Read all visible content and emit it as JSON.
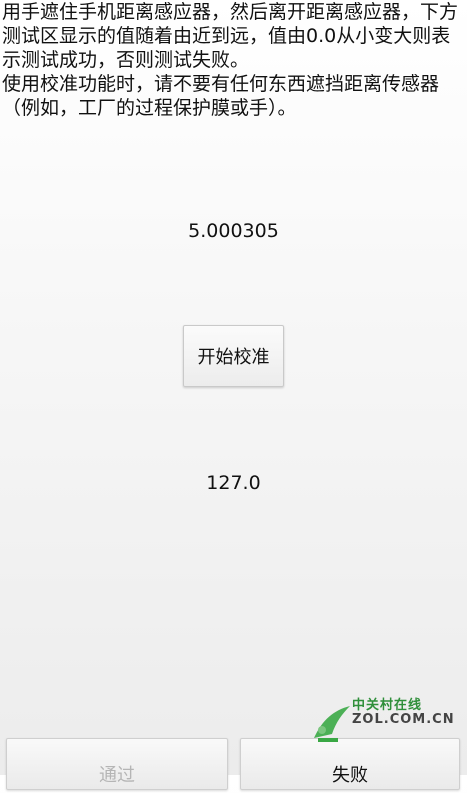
{
  "instructions": "用手遮住手机距离感应器，然后离开距离感应器，下方测试区显示的值随着由近到远，值由0.0从小变大则表示测试成功，否则测试失败。\n使用校准功能时，请不要有任何东西遮挡距离传感器（例如，工厂的过程保护膜或手）。",
  "reading_top": "5.000305",
  "calibrate_button": "开始校准",
  "reading_bottom": "127.0",
  "pass_button": "通过",
  "fail_button": "失败",
  "watermark": {
    "line1": "中关村在线",
    "line2": "ZOL.COM.CN",
    "logo_icon": "zol-logo-icon",
    "colors": {
      "green": "#2f8f3a",
      "gray": "#444444"
    }
  },
  "colors": {
    "pass_text_disabled": "#b5b5b5",
    "text": "#111111"
  }
}
